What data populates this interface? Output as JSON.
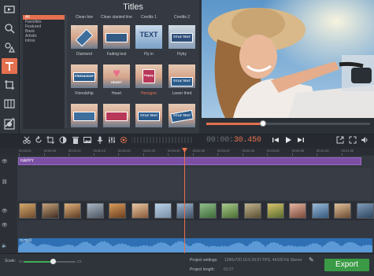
{
  "titles_panel": {
    "header": "Titles",
    "categories": [
      "All",
      "Favorites",
      "Featured",
      "Basic",
      "Artistic",
      "Intros"
    ],
    "columns": [
      "Clean line",
      "Clean slanted line",
      "Credits 1",
      "Credits 2"
    ],
    "rows": [
      [
        "Diamond",
        "Fading text",
        "Fly in",
        "Flyby"
      ],
      [
        "Friendship",
        "Heart",
        "Hexagon",
        "Lower third"
      ]
    ],
    "thumb_texts": {
      "fly_in": "TEXT",
      "flyby": "TITLE TEXT",
      "friendship": "FRIENDSHIP",
      "heart": "HEART",
      "hexagon": "Happy",
      "lower_third": "TITLE TEXT",
      "row3_2": "TITLE TEXT",
      "row3_3": "TITLE TEXT"
    }
  },
  "timecode": {
    "grey": "00:00:",
    "orange": "30.450"
  },
  "ruler_ticks": [
    "00:00:00",
    "00:00:05",
    "00:00:10",
    "00:00:15",
    "00:00:20",
    "00:00:25",
    "00:00:30",
    "00:00:35",
    "00:00:40",
    "00:00:45",
    "00:00:50",
    "00:00:55",
    "00:01:00",
    "00:01:05"
  ],
  "timeline": {
    "title_clip": "HAPPY",
    "audio_clip": "ry.mp3"
  },
  "footer": {
    "scale_label": "Scale:",
    "settings_label": "Project settings:",
    "settings_value": "1280x720 16:9 29.97 FPS, 44100 Hz Stereo",
    "length_label": "Project length:",
    "length_value": "01:27",
    "export_label": "Export"
  },
  "colors": {
    "accent": "#e4704f",
    "export_green": "#3a9a45",
    "title_clip": "#7b4fa3",
    "audio_clip": "#2f6fb3"
  },
  "icons": [
    "video-icon",
    "filter-magnify-icon",
    "shapes-icon",
    "titles-T-icon",
    "crop-icon",
    "transitions-icon",
    "magic-wand-icon",
    "zoom-icon"
  ]
}
